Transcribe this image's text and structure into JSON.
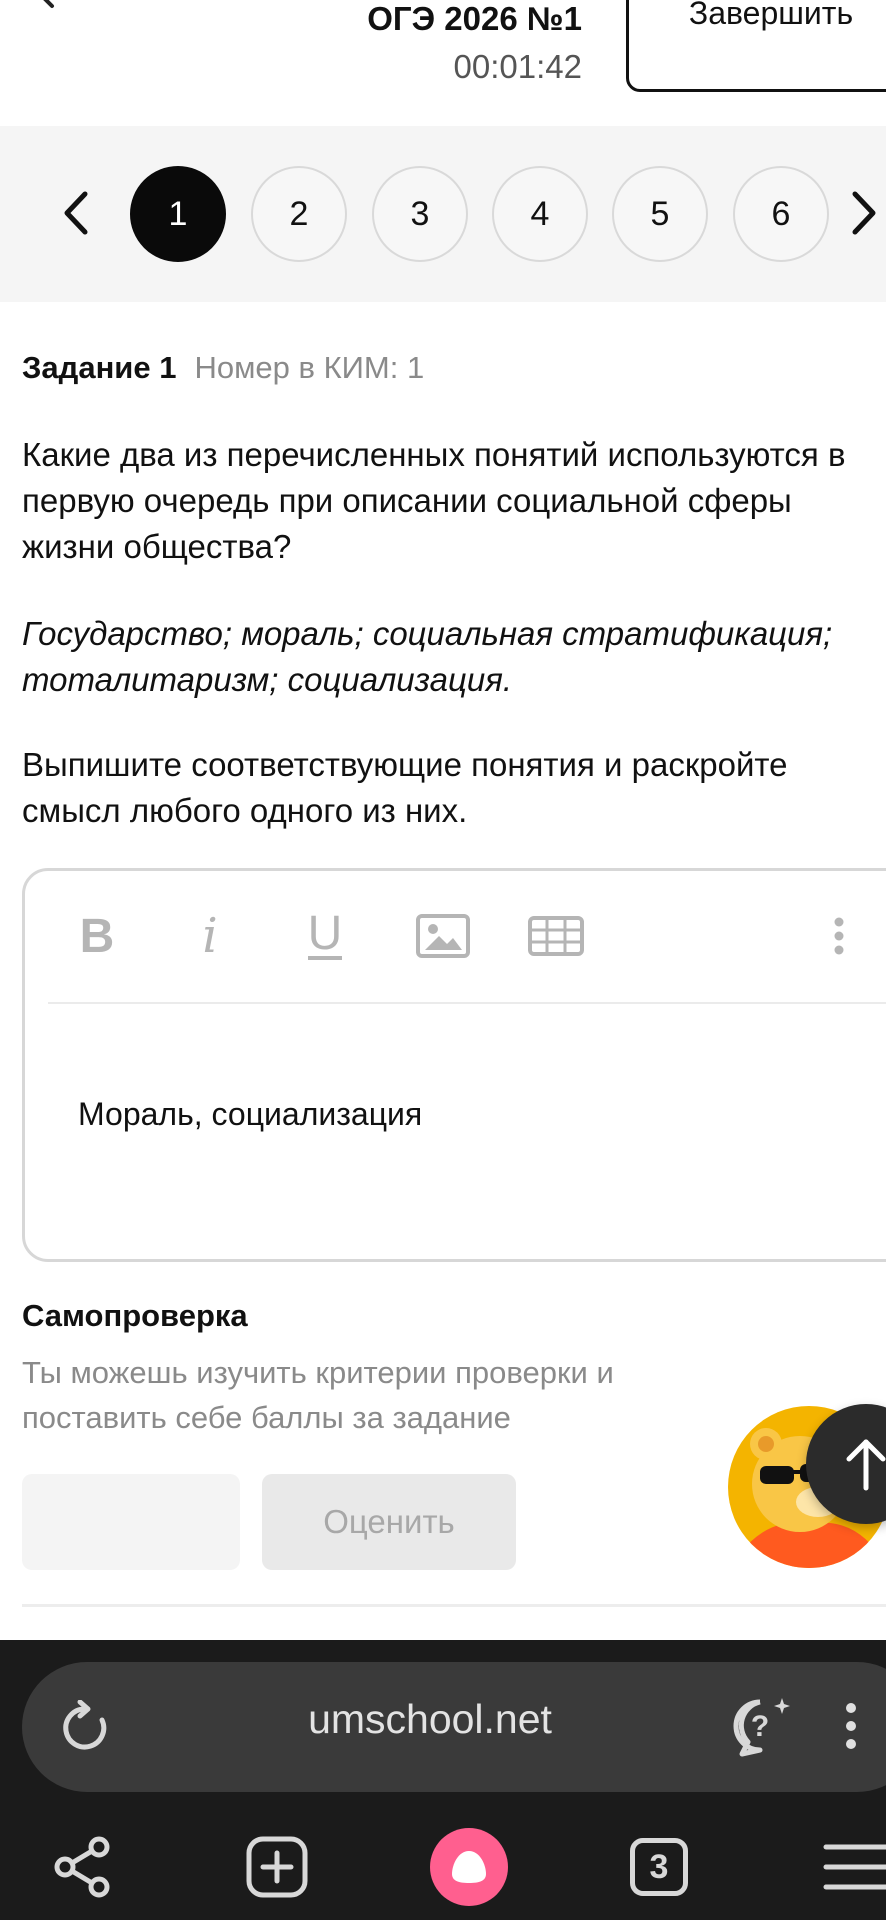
{
  "header": {
    "title": "ОГЭ 2026 №1",
    "timer": "00:01:42",
    "finish_label": "Завершить"
  },
  "task_nav": {
    "items": [
      "1",
      "2",
      "3",
      "4",
      "5",
      "6"
    ],
    "active": "1"
  },
  "task": {
    "number_label": "Задание 1",
    "kim_label": "Номер в КИМ: 1",
    "question": "Какие два из перечисленных понятий используются в первую очередь при описании социальной сферы жизни общества?",
    "concepts": "Государство; мораль; социальная стратификация; тоталитаризм; социализация.",
    "instruction": "Выпишите соответствующие понятия и раскройте смысл любого одного из них."
  },
  "editor": {
    "toolbar": {
      "bold": "B",
      "italic": "i",
      "underline": "U",
      "image_icon": "image-icon",
      "table_icon": "table-icon",
      "more_icon": "more-vertical-icon"
    },
    "answer_text": "Мораль, социализация"
  },
  "self_check": {
    "title": "Самопроверка",
    "description": "Ты можешь изучить критерии проверки и поставить себе баллы за задание",
    "rate_label": "Оценить"
  },
  "browser": {
    "url": "umschool.net",
    "tabs_count": "3"
  },
  "colors": {
    "active_circle": "#0a0a0a",
    "nav_background": "#f5f5f5",
    "browser_background": "#1b1b1b",
    "address_bar": "#3a3a3a",
    "alice_accent": "#ff5f8f",
    "muted_text": "#8a8a8a"
  }
}
